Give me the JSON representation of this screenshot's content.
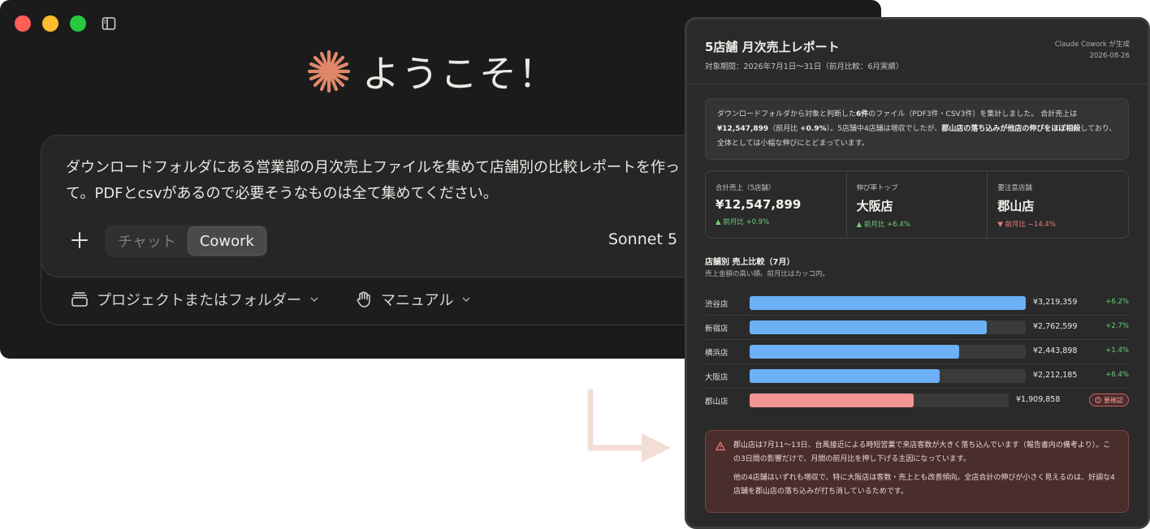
{
  "app": {
    "welcome": "ようこそ！",
    "prompt_text": "ダウンロードフォルダにある営業部の月次売上ファイルを集めて店舗別の比較レポートを作って。PDFとcsvがあるので必要そうなものは全て集めてください。",
    "modes": {
      "chat": "チャット",
      "cowork": "Cowork",
      "selected": "Cowork"
    },
    "model": "Sonnet 5",
    "project_label": "プロジェクトまたはフォルダー",
    "manual_label": "マニュアル",
    "accent_color": "#e0876a"
  },
  "report": {
    "title": "5店舗 月次売上レポート",
    "period": "対象期間：2026年7月1日〜31日（前月比較：6月実績）",
    "generated_by": "Claude Cowork が生成",
    "date": "2026-08-26",
    "summary": {
      "p1": "ダウンロードフォルダから対象と判断した",
      "b1": "6件",
      "p2": "のファイル（PDF3件・CSV3件）を集計しました。 合計売上は ",
      "b2": "¥12,547,899",
      "p3": "（前月比 ",
      "b3": "+0.9%",
      "p4": "）。5店舗中4店舗は増収でしたが、",
      "b4": "郡山店の落ち込みが他店の伸びをほぼ相殺",
      "p5": "しており、全体としては小幅な伸びにとどまっています。"
    },
    "kpis": [
      {
        "label": "合計売上（5店舗）",
        "value": "¥12,547,899",
        "delta": "▲ 前月比 +0.9%",
        "trend": "up"
      },
      {
        "label": "伸び率トップ",
        "value": "大阪店",
        "delta": "▲ 前月比 +6.4%",
        "trend": "up"
      },
      {
        "label": "要注意店舗",
        "value": "郡山店",
        "delta": "▼ 前月比 −14.4%",
        "trend": "down"
      }
    ],
    "chart_title": "店舗別 売上比較（7月）",
    "chart_subtitle": "売上金額の高い順。前月比はカッコ内。",
    "alert": {
      "p1": "郡山店は7月11〜13日、台風接近による時短営業で来店客数が大きく落ち込んでいます（報告書内の備考より）。この3日間の影響だけで、月間の前月比を押し下げる主因になっています。",
      "p2": "他の4店舗はいずれも増収で、特に大阪店は客数・売上とも改善傾向。全店合計の伸びが小さく見えるのは、好調な4店舗を郡山店の落ち込みが打ち消しているためです。"
    }
  },
  "chart_data": {
    "type": "bar",
    "categories": [
      "渋谷店",
      "新宿店",
      "横浜店",
      "大阪店",
      "郡山店"
    ],
    "values": [
      3219359,
      2762599,
      2443898,
      2212185,
      1909858
    ],
    "value_labels": [
      "¥3,219,359",
      "¥2,762,599",
      "¥2,443,898",
      "¥2,212,185",
      "¥1,909,858"
    ],
    "deltas": [
      "+6.2%",
      "+2.7%",
      "+1.4%",
      "+6.4%",
      ""
    ],
    "flags": [
      "",
      "",
      "",
      "",
      "要確認"
    ],
    "colors": {
      "normal": "#6cb0f5",
      "warn": "#f49595"
    },
    "title": "店舗別 売上比較（7月）",
    "xlabel": "",
    "ylabel": ""
  }
}
